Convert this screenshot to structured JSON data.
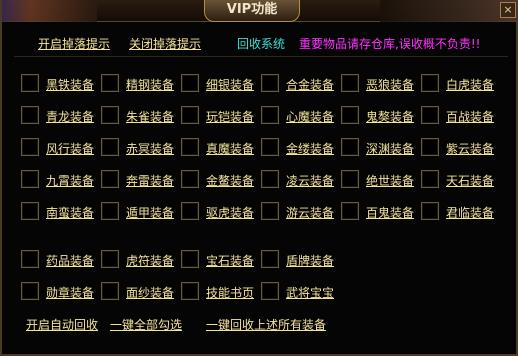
{
  "window": {
    "title": "VIP功能",
    "close_glyph": "×"
  },
  "toolbar": {
    "open_drop_tip": "开启掉落提示",
    "close_drop_tip": "关闭掉落提示",
    "recycle_system": "回收系统",
    "warning": "重要物品请存仓库,误收概不负责!!",
    "colors": {
      "yellow": "#f3e39a",
      "cyan": "#36e0d6",
      "magenta": "#ff33ff"
    }
  },
  "equipment_rows": [
    [
      "黑铁装备",
      "精钢装备",
      "细银装备",
      "合金装备",
      "恶狼装备",
      "白虎装备"
    ],
    [
      "青龙装备",
      "朱雀装备",
      "玩铠装备",
      "心魔装备",
      "鬼獒装备",
      "百战装备"
    ],
    [
      "风行装备",
      "赤冥装备",
      "真魔装备",
      "金缕装备",
      "深渊装备",
      "紫云装备"
    ],
    [
      "九霄装备",
      "奔雷装备",
      "金鳌装备",
      "凌云装备",
      "绝世装备",
      "天石装备"
    ],
    [
      "南蛮装备",
      "遁甲装备",
      "驱虎装备",
      "游云装备",
      "百鬼装备",
      "君临装备"
    ]
  ],
  "misc_rows": [
    [
      "药品装备",
      "虎符装备",
      "宝石装备",
      "盾牌装备"
    ],
    [
      "勋章装备",
      "面纱装备",
      "技能书页",
      "武将宝宝"
    ]
  ],
  "bottom": {
    "auto_recycle": "开启自动回收",
    "select_all": "一键全部勾选",
    "recycle_all": "一键回收上述所有装备"
  }
}
